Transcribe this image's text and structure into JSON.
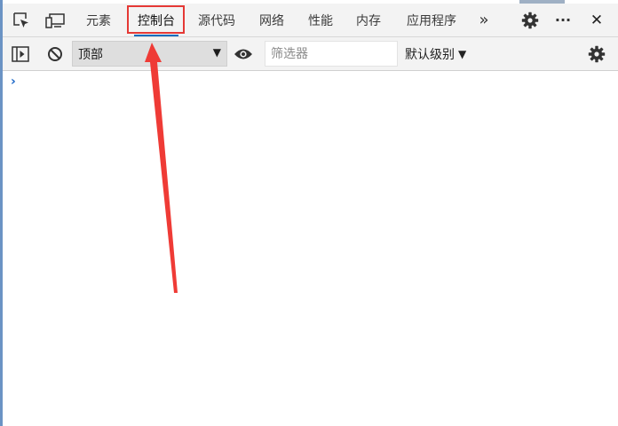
{
  "tabs": [
    {
      "label": "元素",
      "active": false
    },
    {
      "label": "控制台",
      "active": true
    },
    {
      "label": "源代码",
      "active": false
    },
    {
      "label": "网络",
      "active": false
    },
    {
      "label": "性能",
      "active": false
    },
    {
      "label": "内存",
      "active": false
    },
    {
      "label": "应用程序",
      "active": false
    }
  ],
  "tabbar": {
    "more_tabs_label": "»",
    "more_options_label": "···",
    "close_label": "✕",
    "icons": [
      "inspect-element-icon",
      "device-emulation-icon",
      "more-tabs-icon",
      "settings-icon",
      "more-options-icon",
      "close-icon"
    ]
  },
  "toolbar": {
    "context_select_value": "顶部",
    "filter_placeholder": "筛选器",
    "log_levels_label": "默认级别",
    "icons": [
      "show-sidebar-icon",
      "clear-console-icon",
      "live-expression-eye-icon",
      "console-settings-icon"
    ]
  },
  "console": {
    "prompt_symbol": "›"
  },
  "colors": {
    "annotation": "#e53935",
    "accent": "#0f6cbd",
    "prompt": "#1a66c8"
  }
}
